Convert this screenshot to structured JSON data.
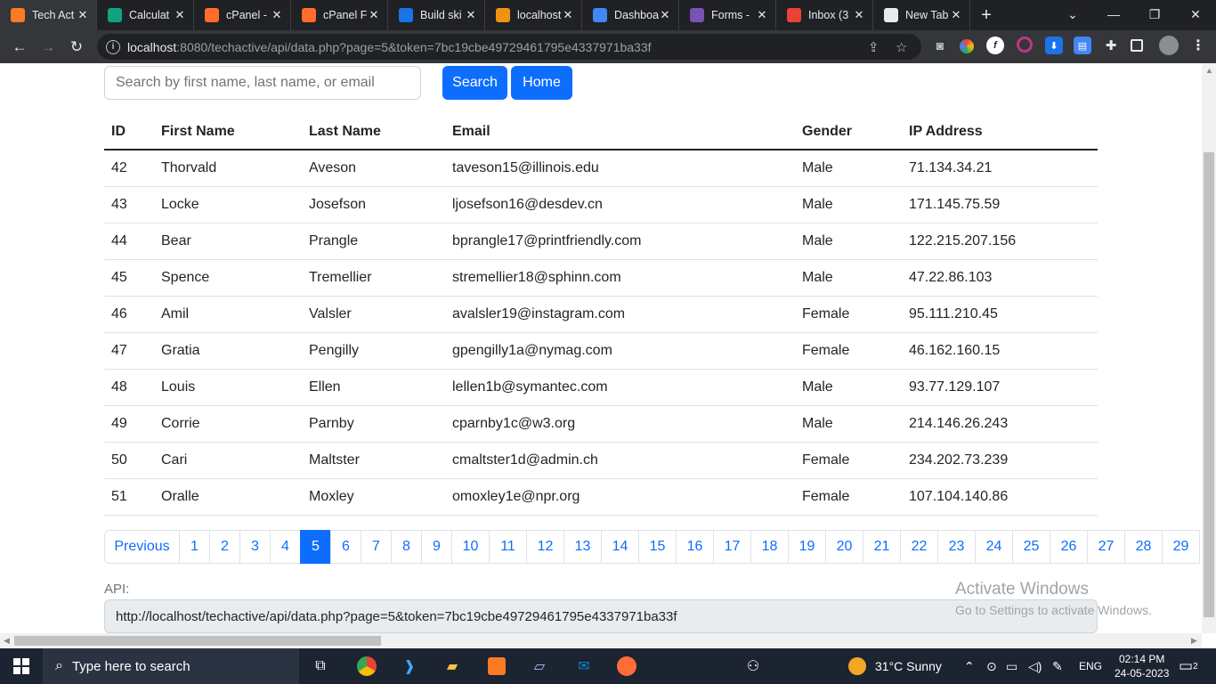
{
  "browser": {
    "tabs": [
      {
        "title": "Tech Act",
        "icon": "xampp-icon",
        "color": "#fb7a24"
      },
      {
        "title": "Calculat",
        "icon": "chatgpt-icon",
        "color": "#10a37f"
      },
      {
        "title": "cPanel -",
        "icon": "cpanel-icon",
        "color": "#ff6c2c"
      },
      {
        "title": "cPanel Fi",
        "icon": "cpanel-icon",
        "color": "#ff6c2c"
      },
      {
        "title": "Build ski",
        "icon": "build-icon",
        "color": "#1a73e8"
      },
      {
        "title": "localhost",
        "icon": "phpmyadmin-icon",
        "color": "#f29111"
      },
      {
        "title": "Dashboa",
        "icon": "dashboard-icon",
        "color": "#4285f4"
      },
      {
        "title": "Forms -",
        "icon": "bootstrap-icon",
        "color": "#7952b3"
      },
      {
        "title": "Inbox (3",
        "icon": "gmail-icon",
        "color": "#ea4335"
      },
      {
        "title": "New Tab",
        "icon": "chrome-icon",
        "color": "#e8eaed"
      }
    ],
    "url_host": "localhost",
    "url_rest": ":8080/techactive/api/data.php?page=5&token=7bc19cbe49729461795e4337971ba33f"
  },
  "search": {
    "placeholder": "Search by first name, last name, or email",
    "search_label": "Search",
    "home_label": "Home"
  },
  "table": {
    "headers": [
      "ID",
      "First Name",
      "Last Name",
      "Email",
      "Gender",
      "IP Address"
    ],
    "rows": [
      [
        "42",
        "Thorvald",
        "Aveson",
        "taveson15@illinois.edu",
        "Male",
        "71.134.34.21"
      ],
      [
        "43",
        "Locke",
        "Josefson",
        "ljosefson16@desdev.cn",
        "Male",
        "171.145.75.59"
      ],
      [
        "44",
        "Bear",
        "Prangle",
        "bprangle17@printfriendly.com",
        "Male",
        "122.215.207.156"
      ],
      [
        "45",
        "Spence",
        "Tremellier",
        "stremellier18@sphinn.com",
        "Male",
        "47.22.86.103"
      ],
      [
        "46",
        "Amil",
        "Valsler",
        "avalsler19@instagram.com",
        "Female",
        "95.111.210.45"
      ],
      [
        "47",
        "Gratia",
        "Pengilly",
        "gpengilly1a@nymag.com",
        "Female",
        "46.162.160.15"
      ],
      [
        "48",
        "Louis",
        "Ellen",
        "lellen1b@symantec.com",
        "Male",
        "93.77.129.107"
      ],
      [
        "49",
        "Corrie",
        "Parnby",
        "cparnby1c@w3.org",
        "Male",
        "214.146.26.243"
      ],
      [
        "50",
        "Cari",
        "Maltster",
        "cmaltster1d@admin.ch",
        "Female",
        "234.202.73.239"
      ],
      [
        "51",
        "Oralle",
        "Moxley",
        "omoxley1e@npr.org",
        "Female",
        "107.104.140.86"
      ]
    ]
  },
  "pagination": {
    "previous_label": "Previous",
    "pages": [
      "1",
      "2",
      "3",
      "4",
      "5",
      "6",
      "7",
      "8",
      "9",
      "10",
      "11",
      "12",
      "13",
      "14",
      "15",
      "16",
      "17",
      "18",
      "19",
      "20",
      "21",
      "22",
      "23",
      "24",
      "25",
      "26",
      "27",
      "28",
      "29"
    ],
    "active": "5"
  },
  "api": {
    "label": "API:",
    "value": "http://localhost/techactive/api/data.php?page=5&token=7bc19cbe49729461795e4337971ba33f"
  },
  "watermark": {
    "line1": "Activate Windows",
    "line2": "Go to Settings to activate Windows."
  },
  "taskbar": {
    "search_placeholder": "Type here to search",
    "weather": "31°C  Sunny",
    "language": "ENG",
    "time": "02:14 PM",
    "date": "24-05-2023",
    "notification_count": "2"
  },
  "colors": {
    "primary": "#0d6efd",
    "chrome_dark": "#202124",
    "taskbar": "#1c2331"
  }
}
